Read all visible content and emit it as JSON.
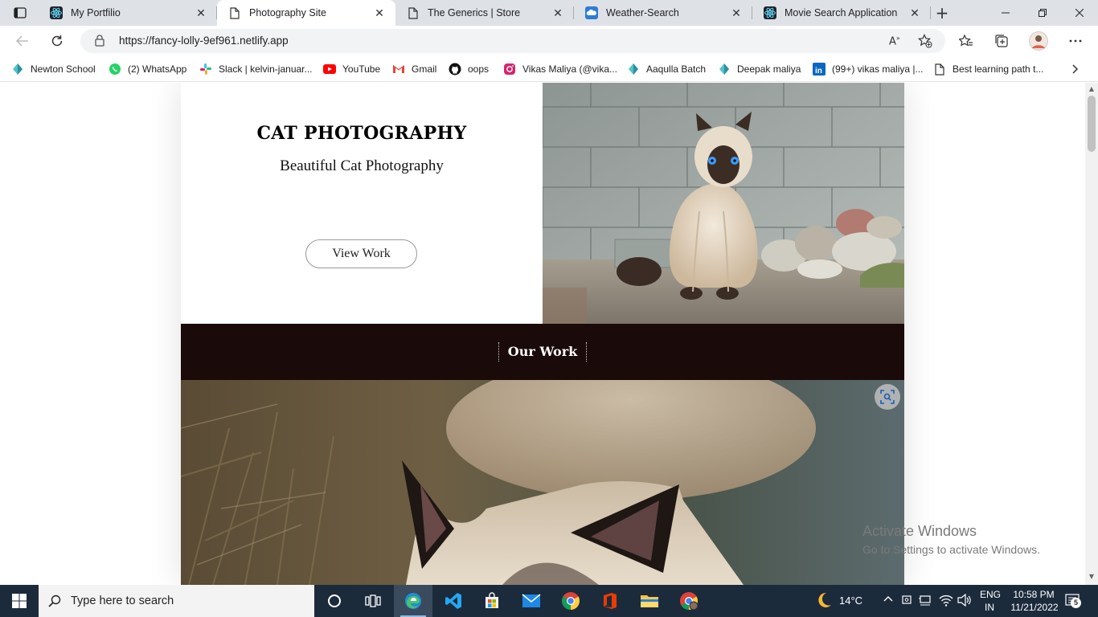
{
  "browser": {
    "tabs": [
      {
        "label": "My Portfilio",
        "icon": "react-icon",
        "active": false
      },
      {
        "label": "Photography Site",
        "icon": "page-icon",
        "active": true
      },
      {
        "label": "The Generics | Store",
        "icon": "page-icon",
        "active": false
      },
      {
        "label": "Weather-Search",
        "icon": "weather-icon",
        "active": false
      },
      {
        "label": "Movie Search Application",
        "icon": "react-icon",
        "active": false
      }
    ],
    "url": "https://fancy-lolly-9ef961.netlify.app",
    "bookmarks": [
      {
        "label": "Newton School",
        "icon": "newton-icon"
      },
      {
        "label": "(2) WhatsApp",
        "icon": "whatsapp-icon"
      },
      {
        "label": "Slack | kelvin-januar...",
        "icon": "slack-icon"
      },
      {
        "label": "YouTube",
        "icon": "youtube-icon"
      },
      {
        "label": "Gmail",
        "icon": "gmail-icon"
      },
      {
        "label": "oops",
        "icon": "github-icon"
      },
      {
        "label": "Vikas Maliya (@vika...",
        "icon": "instagram-icon"
      },
      {
        "label": "Aaqulla Batch",
        "icon": "newton-icon"
      },
      {
        "label": "Deepak maliya",
        "icon": "newton-icon"
      },
      {
        "label": "(99+) vikas maliya |...",
        "icon": "linkedin-icon"
      },
      {
        "label": "Best learning path t...",
        "icon": "page-icon"
      }
    ]
  },
  "page": {
    "hero": {
      "title": "CAT PHOTOGRAPHY",
      "subtitle": "Beautiful Cat Photography",
      "button": "View Work"
    },
    "section_title": "Our Work"
  },
  "watermark": {
    "line1": "Activate Windows",
    "line2": "Go to Settings to activate Windows."
  },
  "taskbar": {
    "search_placeholder": "Type here to search",
    "weather": "14°C",
    "lang_top": "ENG",
    "lang_bottom": "IN",
    "time": "10:58 PM",
    "date": "11/21/2022",
    "notifications": "5"
  },
  "colors": {
    "band": "#1a0a09",
    "taskbar": "#1c2b3c",
    "tabstrip": "#dee1e6"
  }
}
